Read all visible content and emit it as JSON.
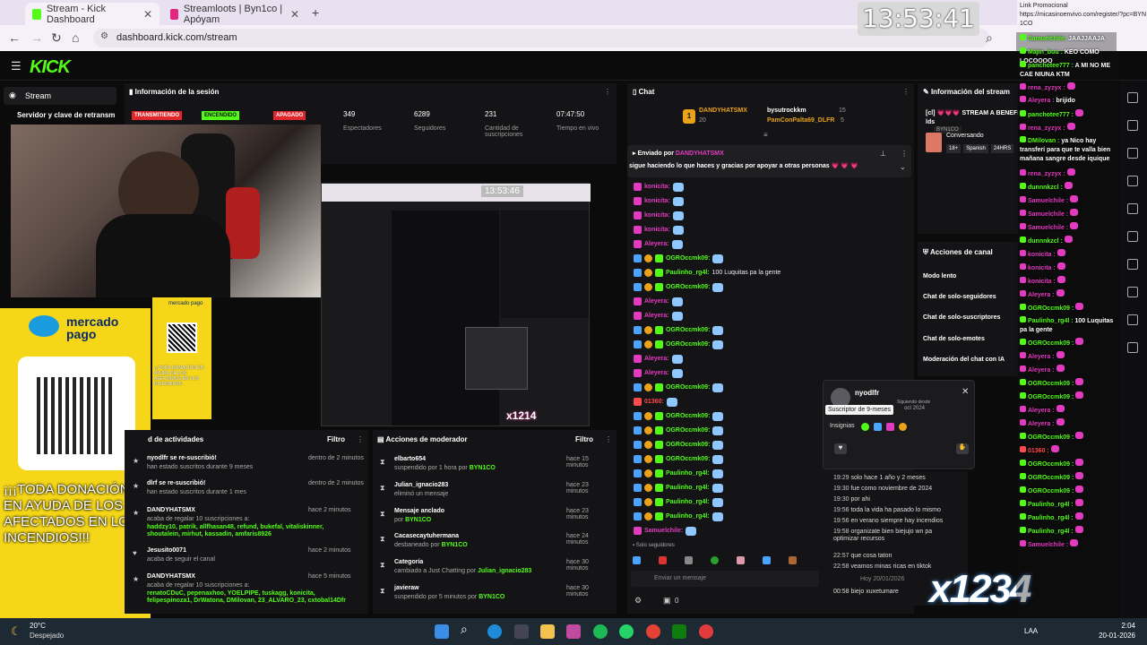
{
  "browser": {
    "tabs": [
      {
        "label": "Stream - Kick Dashboard",
        "active": true
      },
      {
        "label": "Streamloots | Byn1co | Apóyam",
        "active": false
      }
    ],
    "url": "dashboard.kick.com/stream",
    "new_tab": "+"
  },
  "overlay": {
    "clock": "13:53:41",
    "promo_title": "Link Promocional",
    "promo_url": "https://micasinoenvivo.com/register/?pc=BYN1CO",
    "mercado_pago": "mercado pago",
    "mercado_pago_small": "mercado pago",
    "donation_text": "¡¡¡TODA DONACIÓN EN AYUDA DE LOS AFECTADOS EN LOS INCENDIOS!!!",
    "donation_small": "¡¡¡TODA DONACIÓN EN AYUDA DE LOS AFECTADOS EN LOS INCENDIOS!!!",
    "inner_clock": "13:53:46",
    "watermark": "x1234",
    "watermark_small": "x1234",
    "small_watermark": "x1214"
  },
  "sidebar": {
    "stream_label": "Stream",
    "server_key": "Servidor y clave de retransm"
  },
  "session": {
    "title": "Información de la sesión",
    "badges": [
      {
        "label": "TRANSMITIENDO",
        "color": "#e0272b"
      },
      {
        "label": "ENCENDIDO",
        "color": "#53fc18"
      },
      {
        "label": "APAGADO",
        "color": "#e0272b"
      }
    ],
    "stats": [
      {
        "value": "349",
        "label": "Espectadores"
      },
      {
        "value": "6289",
        "label": "Seguidores"
      },
      {
        "value": "231",
        "label": "Cantidad de suscripciones"
      },
      {
        "value": "07:47:50",
        "label": "Tiempo en vivo"
      }
    ]
  },
  "activity": {
    "title": "d de actividades",
    "filter": "Filtro",
    "items": [
      {
        "user": "nyodlfr se re-suscribió!",
        "desc": "han estado suscritos durante 9 meses",
        "time": "dentro de 2 minutos"
      },
      {
        "user": "dlrf se re-suscribió!",
        "desc": "han estado suscritos durante 1 mes",
        "time": "dentro de 2 minutos"
      },
      {
        "user": "DANDYHATSMX",
        "desc": "acaba de regalar 10 suscripciones a:",
        "list": "haddzy10, patrik, allfhasan48, refund, bukefal, vitaliskinner, shoutalein, mirhut, kassadin, amfaris8926",
        "time": "hace 2 minutos"
      },
      {
        "user": "Jesusito0071",
        "desc": "acaba de seguir el canal",
        "time": "hace 2 minutos"
      },
      {
        "user": "DANDYHATSMX",
        "desc": "acaba de regalar 10 suscripciones a:",
        "list": "renatoCDuC, pepenaxhoo, YOELPIPE, tuskagg, konicita, felipespinoza1, DrWatona, DMilovan, 23_ALVARO_23, cxtobal14Dfr",
        "time": "hace 5 minutos"
      }
    ]
  },
  "modactions": {
    "title": "Acciones de moderador",
    "filter": "Filtro",
    "items": [
      {
        "user": "elbarto654",
        "desc": "suspendido por 1 hora por",
        "by": "BYN1CO",
        "time": "hace 15 minutos"
      },
      {
        "user": "Julian_ignacio283",
        "desc": "eliminó un mensaje",
        "by": "",
        "time": "hace 23 minutos"
      },
      {
        "user": "Mensaje anclado",
        "desc": "por",
        "by": "BYN1CO",
        "time": "hace 23 minutos"
      },
      {
        "user": "Cacasecaytuhermana",
        "desc": "desbaneado por",
        "by": "BYN1CO",
        "time": "hace 24 minutos"
      },
      {
        "user": "Categoría",
        "desc": "cambiado a Just Chatting por",
        "by": "Julian_ignacio283",
        "time": "hace 30 minutos"
      },
      {
        "user": "javieraw",
        "desc": "suspendido por 5 minutos por",
        "by": "BYN1CO",
        "time": "hace 30 minutos"
      }
    ]
  },
  "chat": {
    "title": "Chat",
    "top_gifters": [
      {
        "name": "DANDYHATSMX",
        "count": "20"
      },
      {
        "name": "bysutrockkm",
        "count": "15"
      },
      {
        "name": "PamConPalta69_DLFR",
        "count": "5"
      }
    ],
    "pinned_by": "Enviado por",
    "pinned_user": "DANDYHATSMX",
    "pinned_msg": "sigue haciendo lo que haces y gracias por apoyar a otras personas 💗 💗 💗",
    "messages": [
      {
        "user": "konicita:",
        "text": "",
        "color": "#e23bbf"
      },
      {
        "user": "konicita:",
        "text": "",
        "color": "#e23bbf"
      },
      {
        "user": "konicita:",
        "text": "",
        "color": "#e23bbf"
      },
      {
        "user": "konicita:",
        "text": "",
        "color": "#e23bbf"
      },
      {
        "user": "Aleyera:",
        "text": "",
        "color": "#e23bbf"
      },
      {
        "user": "OGROccmk09:",
        "text": "",
        "color": "#53fc18"
      },
      {
        "user": "Paulinho_rg4l:",
        "text": "100 Luquitas pa la gente",
        "color": "#53fc18"
      },
      {
        "user": "OGROccmk09:",
        "text": "",
        "color": "#53fc18"
      },
      {
        "user": "Aleyera:",
        "text": "",
        "color": "#e23bbf"
      },
      {
        "user": "Aleyera:",
        "text": "",
        "color": "#e23bbf"
      },
      {
        "user": "OGROccmk09:",
        "text": "",
        "color": "#53fc18"
      },
      {
        "user": "OGROccmk09:",
        "text": "",
        "color": "#53fc18"
      },
      {
        "user": "Aleyera:",
        "text": "",
        "color": "#e23bbf"
      },
      {
        "user": "Aleyera:",
        "text": "",
        "color": "#e23bbf"
      },
      {
        "user": "OGROccmk09:",
        "text": "",
        "color": "#53fc18"
      },
      {
        "user": "01360:",
        "text": "",
        "color": "#ff4b4b"
      },
      {
        "user": "OGROccmk09:",
        "text": "",
        "color": "#53fc18"
      },
      {
        "user": "OGROccmk09:",
        "text": "",
        "color": "#53fc18"
      },
      {
        "user": "OGROccmk09:",
        "text": "",
        "color": "#53fc18"
      },
      {
        "user": "OGROccmk09:",
        "text": "",
        "color": "#53fc18"
      },
      {
        "user": "Paulinho_rg4l:",
        "text": "",
        "color": "#53fc18"
      },
      {
        "user": "Paulinho_rg4l:",
        "text": "",
        "color": "#53fc18"
      },
      {
        "user": "Paulinho_rg4l:",
        "text": "",
        "color": "#53fc18"
      },
      {
        "user": "Paulinho_rg4l:",
        "text": "",
        "color": "#53fc18"
      },
      {
        "user": "Samuelchile:",
        "text": "",
        "color": "#e23bbf"
      }
    ],
    "followers_only": "Solo seguidores",
    "input_placeholder": "Enviar un mensaje",
    "count": "0"
  },
  "streaminfo": {
    "title": "Información del stream",
    "stream_title": "[cl] 💗💗💗 STREAM A BENEFICIO ...",
    "line2": "lds",
    "category": "Conversando",
    "tags": [
      "18+",
      "Spanish",
      "24HRS"
    ],
    "pill": "BYN1CO"
  },
  "channel_actions": {
    "title": "Acciones de canal",
    "items": [
      "Modo lento",
      "Chat de solo-seguidores",
      "Chat de solo-suscriptores",
      "Chat de solo-emotes",
      "Moderación del chat con IA"
    ]
  },
  "usercard": {
    "name": "nyodlfr",
    "tooltip": "Suscriptor de 9-meses",
    "following_label": "Siguiendo desde",
    "following_date": "oct 2024",
    "badges_label": "Insignias",
    "history": [
      {
        "t": "19:29",
        "m": "solo hace 1 año y 2 meses"
      },
      {
        "t": "19:30",
        "m": "fue como noviembre de 2024"
      },
      {
        "t": "19:30",
        "m": "por ahi"
      },
      {
        "t": "19:56",
        "m": "toda la vida ha pasado lo mismo"
      },
      {
        "t": "19:56",
        "m": "en verano siempre hay incendios"
      },
      {
        "t": "19:58",
        "m": "organizate bien biejujo wn pa optimizar recursos"
      },
      {
        "t": "22:57",
        "m": "que cosa taton"
      },
      {
        "t": "22:58",
        "m": "veamos minas ricas en tiktok"
      }
    ],
    "date_sep": "Hoy 20/01/2026",
    "last_t": "00:58",
    "last_m": "biejo xuxetumare"
  },
  "side_chat": [
    {
      "u": "Samuelchile:",
      "m": "JAAJJAAJA",
      "c": "#53fc18"
    },
    {
      "u": "Majin_buu :",
      "m": "KEO COMO LOCOOOO",
      "c": "#53fc18"
    },
    {
      "u": "panchotee777 :",
      "m": "A MI NO ME CAE NIUNA KTM",
      "c": "#53fc18"
    },
    {
      "u": "rena_zyzyx :",
      "m": "",
      "c": "#e23bbf"
    },
    {
      "u": "Aleyera :",
      "m": "brijido",
      "c": "#e23bbf"
    },
    {
      "u": "panchotee777 :",
      "m": "",
      "c": "#53fc18"
    },
    {
      "u": "rena_zyzyx :",
      "m": "",
      "c": "#e23bbf"
    },
    {
      "u": "DMilovan :",
      "m": "ya Nico hay transferí para que te valla bien mañana sangre desde iquique",
      "c": "#53fc18"
    },
    {
      "u": "rena_zyzyx :",
      "m": "",
      "c": "#e23bbf"
    },
    {
      "u": "dunnnkzcl :",
      "m": "",
      "c": "#53fc18"
    },
    {
      "u": "Samuelchile :",
      "m": "",
      "c": "#e23bbf"
    },
    {
      "u": "Samuelchile :",
      "m": "",
      "c": "#e23bbf"
    },
    {
      "u": "Samuelchile :",
      "m": "",
      "c": "#e23bbf"
    },
    {
      "u": "dunnnkzcl :",
      "m": "",
      "c": "#53fc18"
    },
    {
      "u": "konicita :",
      "m": "",
      "c": "#e23bbf"
    },
    {
      "u": "konicita :",
      "m": "",
      "c": "#e23bbf"
    },
    {
      "u": "konicita :",
      "m": "",
      "c": "#e23bbf"
    },
    {
      "u": "Aleyera :",
      "m": "",
      "c": "#e23bbf"
    },
    {
      "u": "OGROccmk09 :",
      "m": "",
      "c": "#53fc18"
    },
    {
      "u": "Paulinho_rg4l :",
      "m": "100 Luquitas pa la gente",
      "c": "#53fc18"
    },
    {
      "u": "OGROccmk09 :",
      "m": "",
      "c": "#53fc18"
    },
    {
      "u": "Aleyera :",
      "m": "",
      "c": "#e23bbf"
    },
    {
      "u": "Aleyera :",
      "m": "",
      "c": "#e23bbf"
    },
    {
      "u": "OGROccmk09 :",
      "m": "",
      "c": "#53fc18"
    },
    {
      "u": "OGROccmk09 :",
      "m": "",
      "c": "#53fc18"
    },
    {
      "u": "Aleyera :",
      "m": "",
      "c": "#e23bbf"
    },
    {
      "u": "Aleyera :",
      "m": "",
      "c": "#e23bbf"
    },
    {
      "u": "OGROccmk09 :",
      "m": "",
      "c": "#53fc18"
    },
    {
      "u": "01360 :",
      "m": "",
      "c": "#ff4b4b"
    },
    {
      "u": "OGROccmk09 :",
      "m": "",
      "c": "#53fc18"
    },
    {
      "u": "OGROccmk09 :",
      "m": "",
      "c": "#53fc18"
    },
    {
      "u": "OGROccmk09 :",
      "m": "",
      "c": "#53fc18"
    },
    {
      "u": "Paulinho_rg4l :",
      "m": "",
      "c": "#53fc18"
    },
    {
      "u": "Paulinho_rg4l :",
      "m": "",
      "c": "#53fc18"
    },
    {
      "u": "Paulinho_rg4l :",
      "m": "",
      "c": "#53fc18"
    },
    {
      "u": "Samuelchile :",
      "m": "",
      "c": "#e23bbf"
    }
  ],
  "taskbar": {
    "temp": "20°C",
    "weather": "Despejado",
    "time": "2:04",
    "date": "20-01-2026",
    "lang": "LAA"
  }
}
